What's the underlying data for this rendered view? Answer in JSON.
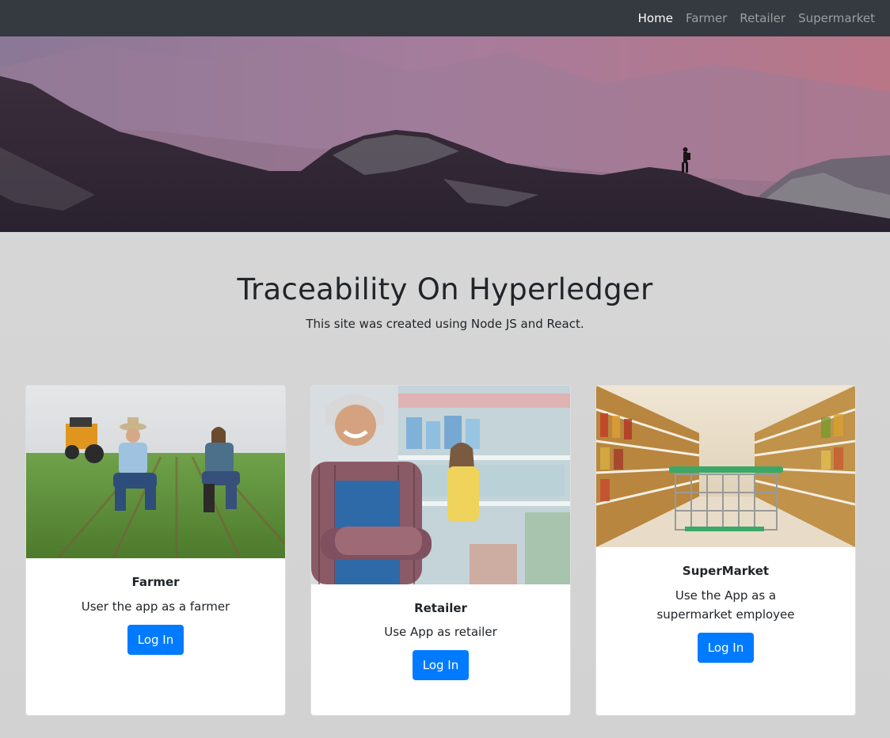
{
  "nav": {
    "items": [
      {
        "label": "Home",
        "active": true
      },
      {
        "label": "Farmer",
        "active": false
      },
      {
        "label": "Retailer",
        "active": false
      },
      {
        "label": "Supermarket",
        "active": false
      }
    ]
  },
  "hero": {
    "image": "mountain-landscape-with-hiker"
  },
  "intro": {
    "title": "Traceability On Hyperledger",
    "subtitle": "This site was created using Node JS and React."
  },
  "cards": [
    {
      "title": "Farmer",
      "text": "User the app as a farmer",
      "button": "Log In",
      "image": "farmers-in-field"
    },
    {
      "title": "Retailer",
      "text": "Use App as retailer",
      "button": "Log In",
      "image": "shopkeeper-in-store"
    },
    {
      "title": "SuperMarket",
      "text": "Use the App as a supermarket employee",
      "button": "Log In",
      "image": "supermarket-aisle-cart"
    }
  ],
  "colors": {
    "navbar": "#343a40",
    "primary": "#007bff",
    "background": "#d8d8d8"
  }
}
